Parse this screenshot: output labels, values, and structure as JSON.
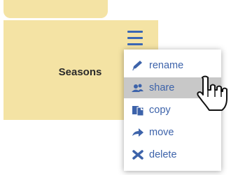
{
  "folder": {
    "name": "Seasons"
  },
  "menu": {
    "items": [
      {
        "label": "rename",
        "icon": "pencil-icon"
      },
      {
        "label": "share",
        "icon": "users-icon",
        "highlighted": true
      },
      {
        "label": "copy",
        "icon": "copy-icon"
      },
      {
        "label": "move",
        "icon": "arrow-right-icon"
      },
      {
        "label": "delete",
        "icon": "x-icon"
      }
    ]
  },
  "colors": {
    "folder": "#f4e3a4",
    "accent": "#3d63aa",
    "highlight": "#c8c8c8"
  }
}
